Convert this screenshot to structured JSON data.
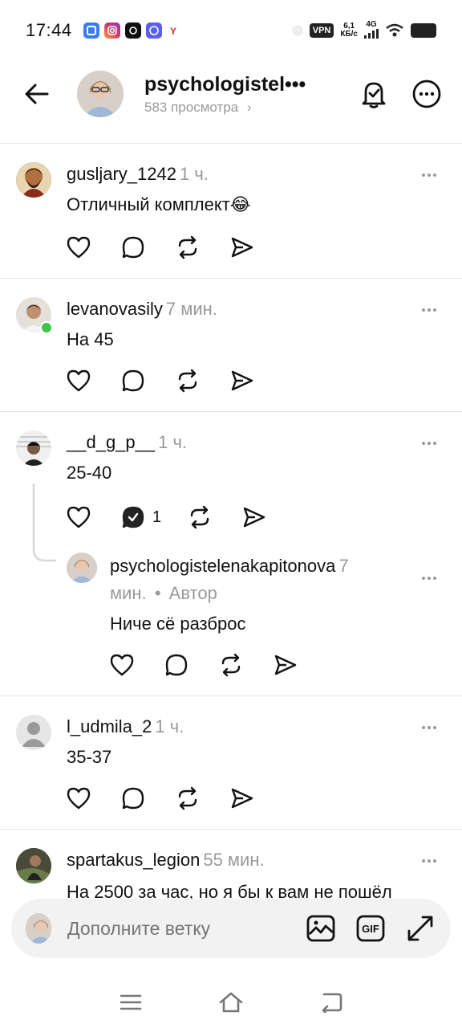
{
  "status_bar": {
    "time": "17:44",
    "vpn": "VPN",
    "speed_value": "6,1",
    "speed_unit": "КБ/с",
    "network": "4G"
  },
  "header": {
    "title": "psychologistel•••",
    "subtitle": "583 просмотра",
    "subtitle_chevron": "›"
  },
  "comments": [
    {
      "user": "gusljary_1242",
      "time": "1 ч.",
      "text": "Отличный комплект😂"
    },
    {
      "user": "levanovasily",
      "time": "7 мин.",
      "text": "На 45"
    },
    {
      "user": "__d_g_p__",
      "time": "1 ч.",
      "text": "25-40",
      "reply_count": "1"
    },
    {
      "user": "l_udmila_2",
      "time": "1 ч.",
      "text": "35-37"
    },
    {
      "user": "spartakus_legion",
      "time": "55 мин.",
      "text": "На 2500 за час, но я бы к вам не пошёл"
    }
  ],
  "reply": {
    "user": "psychologistelenakapitonova",
    "time_part1": "7",
    "time_part2": "мин.",
    "separator": "•",
    "role": "Автор",
    "text": "Ниче сё разброс"
  },
  "composer": {
    "placeholder": "Дополните ветку",
    "gif_label": "GIF"
  },
  "colors": {
    "muted": "#999999",
    "online": "#3cc548",
    "divider": "#e6e6e6"
  }
}
